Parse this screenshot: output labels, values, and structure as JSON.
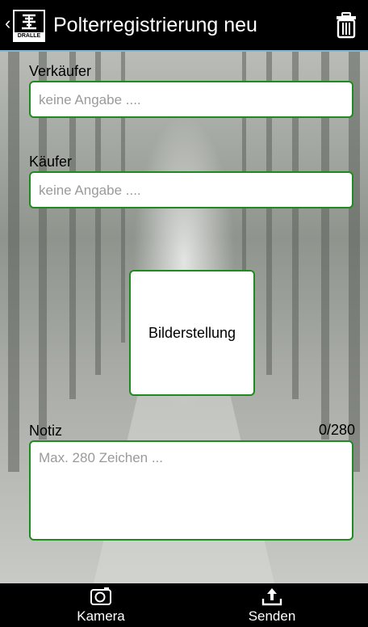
{
  "header": {
    "title": "Polterregistrierung neu",
    "logo_text": "DRALLE"
  },
  "form": {
    "seller": {
      "label": "Verkäufer",
      "placeholder": "keine Angabe ...."
    },
    "buyer": {
      "label": "Käufer",
      "placeholder": "keine Angabe ...."
    },
    "image_button_label": "Bilderstellung",
    "note": {
      "label": "Notiz",
      "counter": "0/280",
      "placeholder": "Max. 280 Zeichen ..."
    }
  },
  "bottom_nav": {
    "camera_label": "Kamera",
    "send_label": "Senden"
  },
  "colors": {
    "accent_border": "#1f8a1f",
    "bar_background": "#000000",
    "header_underline": "#7fb6d6"
  }
}
